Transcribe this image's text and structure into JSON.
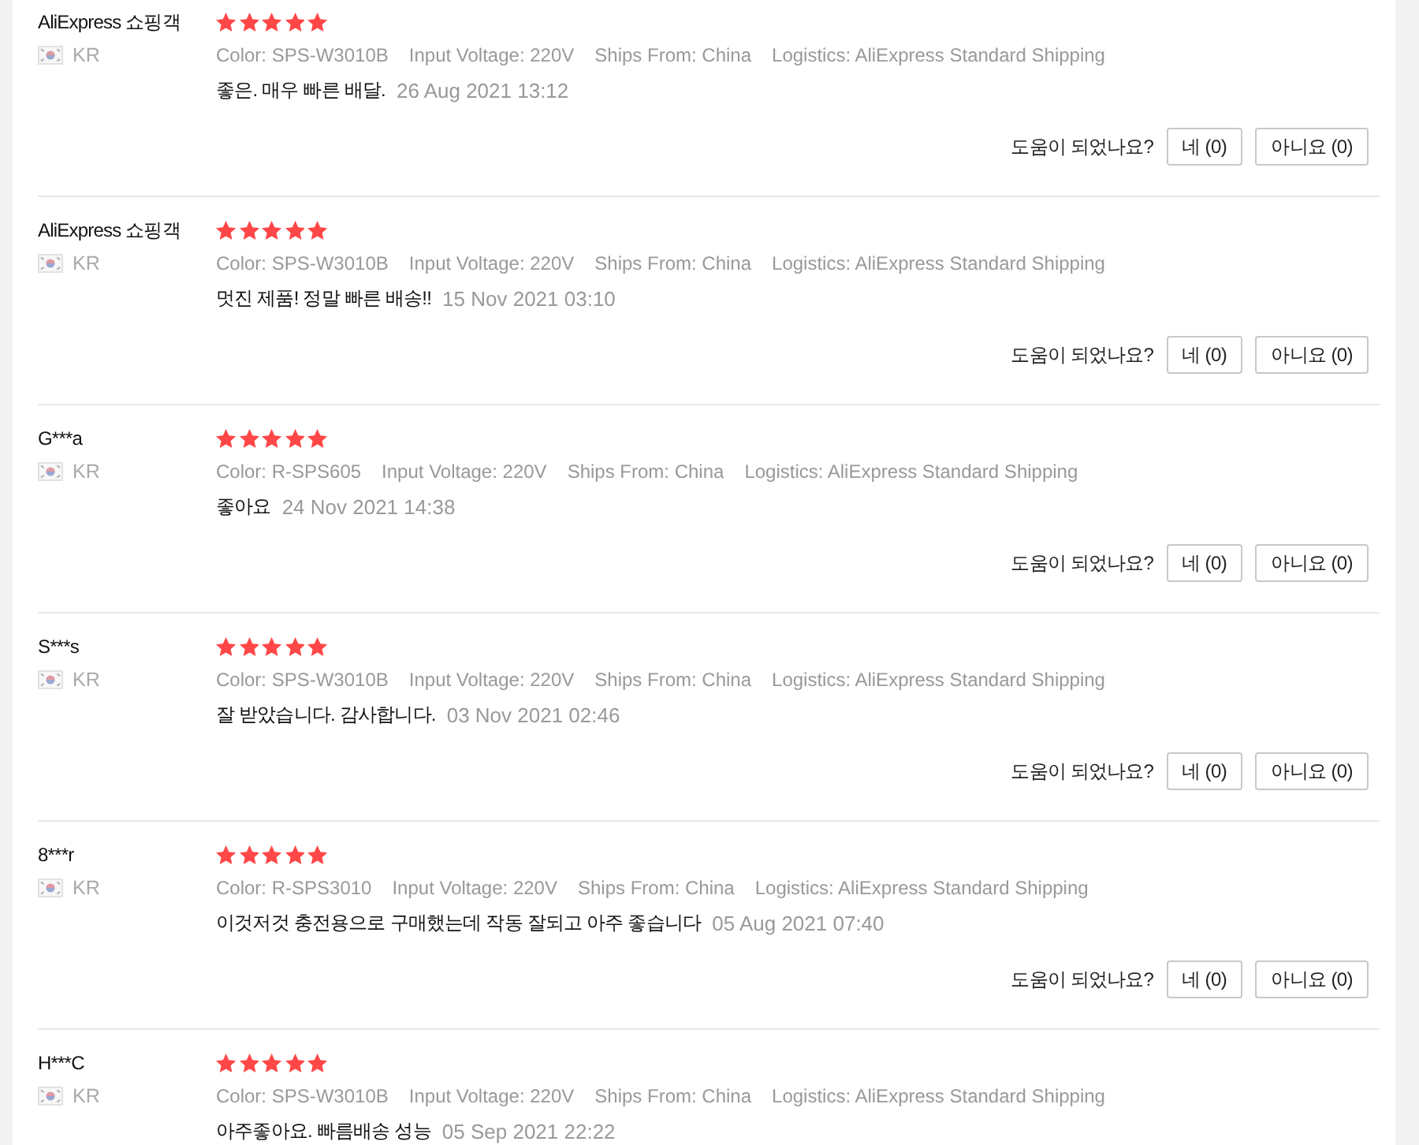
{
  "reviews": [
    {
      "reviewer": "AliExpress 쇼핑객",
      "country": "KR",
      "stars": 5,
      "attributes": [
        "Color: SPS-W3010B",
        "Input Voltage: 220V",
        "Ships From: China",
        "Logistics: AliExpress Standard Shipping"
      ],
      "comment": "좋은. 매우 빠른 배달.",
      "date": "26 Aug 2021 13:12",
      "helpful": {
        "question": "도움이 되었나요?",
        "yes": "네 (0)",
        "no": "아니요 (0)"
      }
    },
    {
      "reviewer": "AliExpress 쇼핑객",
      "country": "KR",
      "stars": 5,
      "attributes": [
        "Color: SPS-W3010B",
        "Input Voltage: 220V",
        "Ships From: China",
        "Logistics: AliExpress Standard Shipping"
      ],
      "comment": "멋진 제품! 정말 빠른 배송!!",
      "date": "15 Nov 2021 03:10",
      "helpful": {
        "question": "도움이 되었나요?",
        "yes": "네 (0)",
        "no": "아니요 (0)"
      }
    },
    {
      "reviewer": "G***a",
      "country": "KR",
      "stars": 5,
      "attributes": [
        "Color: R-SPS605",
        "Input Voltage: 220V",
        "Ships From: China",
        "Logistics: AliExpress Standard Shipping"
      ],
      "comment": "좋아요",
      "date": "24 Nov 2021 14:38",
      "helpful": {
        "question": "도움이 되었나요?",
        "yes": "네 (0)",
        "no": "아니요 (0)"
      }
    },
    {
      "reviewer": "S***s",
      "country": "KR",
      "stars": 5,
      "attributes": [
        "Color: SPS-W3010B",
        "Input Voltage: 220V",
        "Ships From: China",
        "Logistics: AliExpress Standard Shipping"
      ],
      "comment": "잘 받았습니다. 감사합니다.",
      "date": "03 Nov 2021 02:46",
      "helpful": {
        "question": "도움이 되었나요?",
        "yes": "네 (0)",
        "no": "아니요 (0)"
      }
    },
    {
      "reviewer": "8***r",
      "country": "KR",
      "stars": 5,
      "attributes": [
        "Color: R-SPS3010",
        "Input Voltage: 220V",
        "Ships From: China",
        "Logistics: AliExpress Standard Shipping"
      ],
      "comment": "이것저것 충전용으로 구매했는데 작동 잘되고 아주 좋습니다",
      "date": "05 Aug 2021 07:40",
      "helpful": {
        "question": "도움이 되었나요?",
        "yes": "네 (0)",
        "no": "아니요 (0)"
      }
    },
    {
      "reviewer": "H***C",
      "country": "KR",
      "stars": 5,
      "attributes": [
        "Color: SPS-W3010B",
        "Input Voltage: 220V",
        "Ships From: China",
        "Logistics: AliExpress Standard Shipping"
      ],
      "comment": "아주좋아요. 빠름배송 성능",
      "date": "05 Sep 2021 22:22"
    }
  ]
}
